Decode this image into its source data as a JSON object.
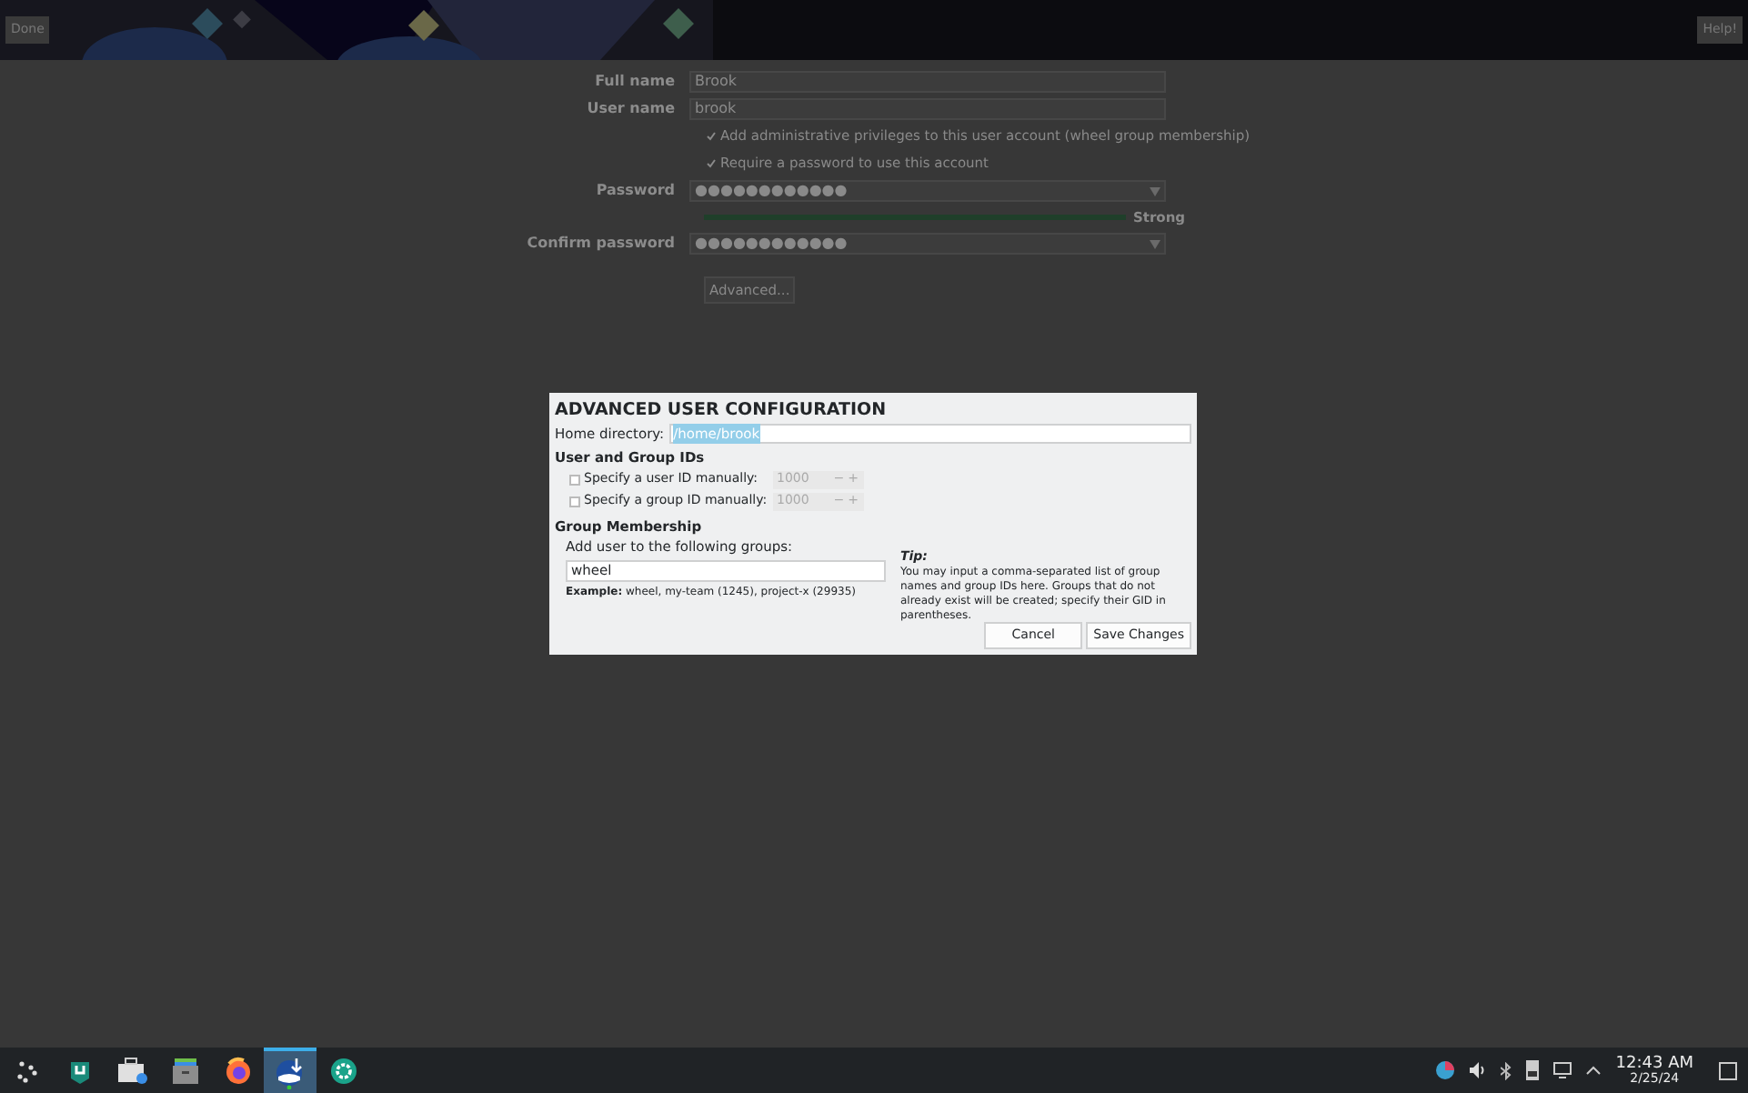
{
  "header": {
    "done_button": "Done",
    "help_button": "Help!"
  },
  "form": {
    "full_name": {
      "label": "Full name",
      "value": "Brook"
    },
    "user_name": {
      "label": "User name",
      "value": "brook"
    },
    "options": [
      {
        "label": "Add administrative privileges to this user account (wheel group membership)",
        "checked": true
      },
      {
        "label": "Require a password to use this account",
        "checked": true
      }
    ],
    "password": {
      "label": "Password",
      "value": "●●●●●●●●●●●●"
    },
    "strength": {
      "level": 1,
      "label": "Strong"
    },
    "confirm_password": {
      "label": "Confirm password",
      "value": "●●●●●●●●●●●●"
    },
    "advanced_button": "Advanced..."
  },
  "dialog": {
    "title": "ADVANCED USER CONFIGURATION",
    "home_directory": {
      "label": "Home directory:",
      "value": "/home/brook",
      "selected": true
    },
    "ids_heading": "User and Group IDs",
    "ids": [
      {
        "label": "Specify a user ID manually:",
        "checked": false,
        "value": "1000",
        "minus": "−",
        "plus": "+"
      },
      {
        "label": "Specify a group ID manually:",
        "checked": false,
        "value": "1000",
        "minus": "−",
        "plus": "+"
      }
    ],
    "group_heading": "Group Membership",
    "groups_label": "Add user to the following groups:",
    "groups_value": "wheel",
    "example": "**Example:** wheel, my-team (1245), project-x (29935)",
    "tip_title": "Tip:",
    "tip_text": "You may input a comma-separated list of group names and group IDs here. Groups that do not already exist will be created; specify their GID in parentheses.",
    "buttons": [
      "Cancel",
      "Save Changes"
    ]
  },
  "taskbar": {
    "apps": [
      {
        "kind": "launcher",
        "selected": false
      },
      {
        "kind": "discover",
        "selected": false
      },
      {
        "kind": "store",
        "selected": false
      },
      {
        "kind": "files",
        "selected": false
      },
      {
        "kind": "browser",
        "selected": false
      },
      {
        "kind": "installer",
        "selected": true
      },
      {
        "kind": "gear",
        "selected": false
      }
    ],
    "time": "12:43 AM",
    "date": "2/25/24"
  }
}
